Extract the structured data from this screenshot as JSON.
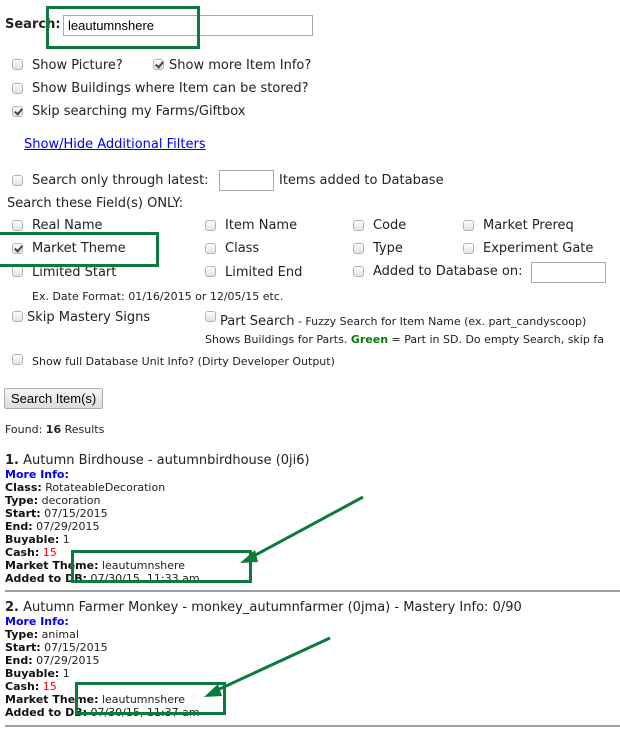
{
  "search": {
    "label": "Search:",
    "value": "leautumnshere"
  },
  "options": {
    "show_picture": {
      "label": "Show Picture?",
      "checked": false
    },
    "show_more_info": {
      "label": "Show more Item Info?",
      "checked": true
    },
    "show_buildings": {
      "label": "Show Buildings where Item can be stored?",
      "checked": false
    },
    "skip_farms": {
      "label": "Skip searching my Farms/Giftbox",
      "checked": true
    }
  },
  "filters_link": "Show/Hide Additional Filters",
  "latest": {
    "label": "Search only through latest:",
    "value": "",
    "suffix": "Items added to Database"
  },
  "fields_heading": "Search these Field(s) ONLY:",
  "fields": {
    "real_name": "Real Name",
    "item_name": "Item Name",
    "code": "Code",
    "market_prereq": "Market Prereq",
    "market_theme": "Market Theme",
    "class": "Class",
    "type": "Type",
    "experiment_gate": "Experiment Gate",
    "limited_start": "Limited Start",
    "limited_end": "Limited End",
    "added_on": "Added to Database on:",
    "added_on_value": ""
  },
  "date_hint": "Ex. Date Format: 01/16/2015 or 12/05/15 etc.",
  "mastery": "Skip Mastery Signs",
  "part_search": {
    "label": "Part Search",
    "desc": " - Fuzzy Search for Item Name (ex. part_candyscoop)",
    "note_pre": "Shows Buildings for Parts. ",
    "note_green": "Green",
    "note_post": " = Part in SD. Do empty Search, skip fa"
  },
  "dev_output": "Show full Database Unit Info? (Dirty Developer Output)",
  "search_button": "Search Item(s)",
  "found": {
    "pre": "Found: ",
    "count": "16",
    "post": " Results"
  },
  "results": [
    {
      "num": "1.",
      "title": " Autumn Birdhouse - autumnbirdhouse (0ji6)",
      "more_info": "More Info:",
      "class_label": "Class:",
      "class": " RotateableDecoration",
      "type_label": "Type:",
      "type": " decoration",
      "start_label": "Start:",
      "start": " 07/15/2015",
      "end_label": "End:",
      "end": " 07/29/2015",
      "buyable_label": "Buyable:",
      "buyable": " 1",
      "cash_label": "Cash:",
      "cash": " 15",
      "theme_label": "Market Theme:",
      "theme": " leautumnshere",
      "added_label": "Added to DB:",
      "added": " 07/30/15, 11:33 am"
    },
    {
      "num": "2.",
      "title": " Autumn Farmer Monkey - monkey_autumnfarmer (0jma) - Mastery Info: 0/90",
      "more_info": "More Info:",
      "type_label": "Type:",
      "type": " animal",
      "start_label": "Start:",
      "start": " 07/15/2015",
      "end_label": "End:",
      "end": " 07/29/2015",
      "buyable_label": "Buyable:",
      "buyable": " 1",
      "cash_label": "Cash:",
      "cash": " 15",
      "theme_label": "Market Theme:",
      "theme": " leautumnshere",
      "added_label": "Added to DB:",
      "added": " 07/30/15, 11:37 am"
    }
  ],
  "colors": {
    "annotation": "#0b7a3e",
    "link": "#0000ee",
    "cash": "#ff0000"
  }
}
